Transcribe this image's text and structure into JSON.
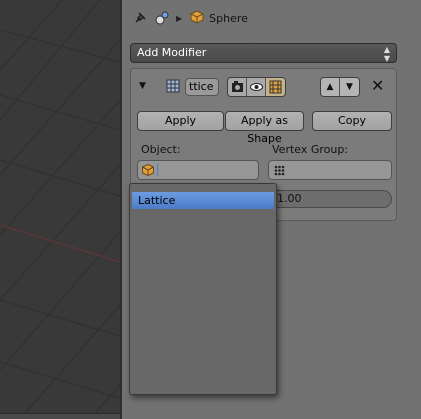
{
  "breadcrumb": {
    "object_name": "Sphere"
  },
  "add_modifier": {
    "label": "Add Modifier"
  },
  "modifier": {
    "name_value": "ttice",
    "buttons": {
      "apply": "Apply",
      "apply_as_shape": "Apply as Shape",
      "copy": "Copy"
    },
    "object_label": "Object:",
    "object_value": "",
    "vertex_group_label": "Vertex Group:",
    "vertex_group_value": "",
    "strength_value": "1.00"
  },
  "dropdown": {
    "items": [
      {
        "label": "Lattice",
        "highlighted": true
      }
    ]
  },
  "colors": {
    "panel_bg": "#727272",
    "viewport_bg": "#393939",
    "highlight": "#5a8ad6",
    "object_icon": "#e0a040"
  },
  "icons": [
    "pin-icon",
    "scene-icon",
    "object-cube-icon",
    "lattice-grid-icon",
    "render-icon",
    "eye-icon",
    "editmode-icon",
    "move-up-icon",
    "move-down-icon",
    "close-icon",
    "vertex-group-icon"
  ]
}
